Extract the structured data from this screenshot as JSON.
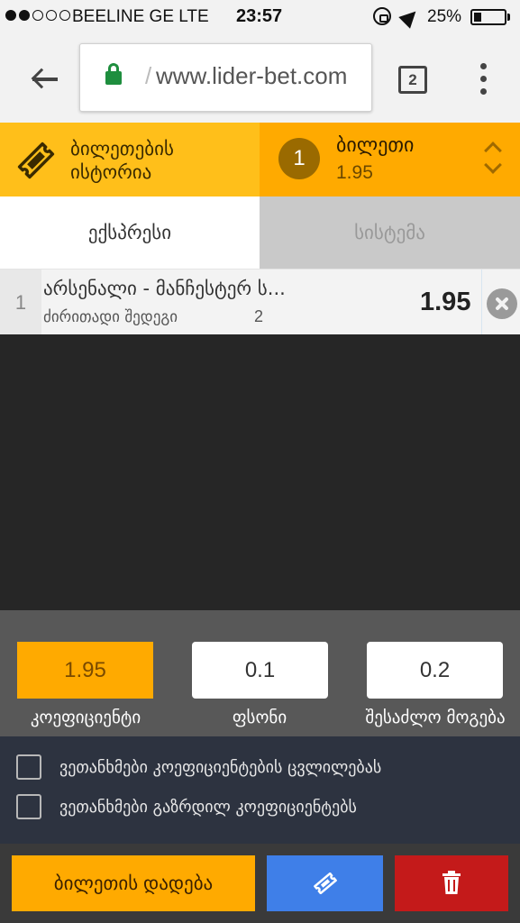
{
  "status_bar": {
    "carrier": "BEELINE GE  LTE",
    "time": "23:57",
    "battery": "25%",
    "battery_level": 0.25
  },
  "browser": {
    "url": "www.lider-bet.com",
    "tab_count": "2"
  },
  "header": {
    "history_label": "ბილეთების ისტორია",
    "ticket_count": "1",
    "ticket_title": "ბილეთი",
    "ticket_odds": "1.95"
  },
  "tabs": {
    "express": "ექსპრესი",
    "system": "სისტემა"
  },
  "bet": {
    "number": "1",
    "match": "არსენალი - მანჩესტერ ს...",
    "market": "ძირითადი შედეგი",
    "outcome": "2",
    "odds": "1.95"
  },
  "summary": {
    "odds_value": "1.95",
    "odds_label": "კოეფიციენტი",
    "stake_value": "0.1",
    "stake_label": "ფსონი",
    "win_value": "0.2",
    "win_label": "შესაძლო მოგება"
  },
  "options": {
    "accept_odds_change": "ვეთანხმები კოეფიციენტების ცვლილებას",
    "accept_boosted_odds": "ვეთანხმები გაზრდილ კოეფიციენტებს"
  },
  "actions": {
    "place_bet": "ბილეთის დადება"
  },
  "colors": {
    "accent": "#ffaa00",
    "save": "#3f7fe8",
    "delete": "#c41a1a"
  }
}
